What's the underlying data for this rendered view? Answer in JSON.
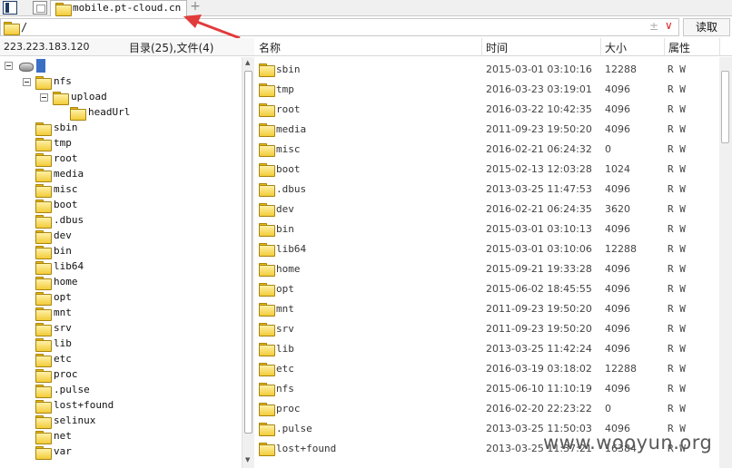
{
  "tabbar": {
    "tab_title": "mobile.pt-cloud.cn",
    "add_symbol": "+"
  },
  "address": {
    "path": "/",
    "plusminus": "±",
    "dropdown": "∨",
    "read_label": "读取"
  },
  "left_panel": {
    "ip": "223.223.183.120",
    "dir_count": "目录(25),文件(4)",
    "tree": [
      {
        "label": "nfs",
        "level": 1
      },
      {
        "label": "upload",
        "level": 2
      },
      {
        "label": "headUrl",
        "level": 3
      },
      {
        "label": "sbin",
        "level": 1
      },
      {
        "label": "tmp",
        "level": 1
      },
      {
        "label": "root",
        "level": 1
      },
      {
        "label": "media",
        "level": 1
      },
      {
        "label": "misc",
        "level": 1
      },
      {
        "label": "boot",
        "level": 1
      },
      {
        "label": ".dbus",
        "level": 1
      },
      {
        "label": "dev",
        "level": 1
      },
      {
        "label": "bin",
        "level": 1
      },
      {
        "label": "lib64",
        "level": 1
      },
      {
        "label": "home",
        "level": 1
      },
      {
        "label": "opt",
        "level": 1
      },
      {
        "label": "mnt",
        "level": 1
      },
      {
        "label": "srv",
        "level": 1
      },
      {
        "label": "lib",
        "level": 1
      },
      {
        "label": "etc",
        "level": 1
      },
      {
        "label": "proc",
        "level": 1
      },
      {
        "label": ".pulse",
        "level": 1
      },
      {
        "label": "lost+found",
        "level": 1
      },
      {
        "label": "selinux",
        "level": 1
      },
      {
        "label": "net",
        "level": 1
      },
      {
        "label": "var",
        "level": 1
      }
    ]
  },
  "file_list": {
    "columns": {
      "name": "名称",
      "time": "时间",
      "size": "大小",
      "attr": "属性"
    },
    "rows": [
      {
        "name": "sbin",
        "time": "2015-03-01 03:10:16",
        "size": "12288",
        "attr": "R W"
      },
      {
        "name": "tmp",
        "time": "2016-03-23 03:19:01",
        "size": "4096",
        "attr": "R W"
      },
      {
        "name": "root",
        "time": "2016-03-22 10:42:35",
        "size": "4096",
        "attr": "R W"
      },
      {
        "name": "media",
        "time": "2011-09-23 19:50:20",
        "size": "4096",
        "attr": "R W"
      },
      {
        "name": "misc",
        "time": "2016-02-21 06:24:32",
        "size": "0",
        "attr": "R W"
      },
      {
        "name": "boot",
        "time": "2015-02-13 12:03:28",
        "size": "1024",
        "attr": "R W"
      },
      {
        "name": ".dbus",
        "time": "2013-03-25 11:47:53",
        "size": "4096",
        "attr": "R W"
      },
      {
        "name": "dev",
        "time": "2016-02-21 06:24:35",
        "size": "3620",
        "attr": "R W"
      },
      {
        "name": "bin",
        "time": "2015-03-01 03:10:13",
        "size": "4096",
        "attr": "R W"
      },
      {
        "name": "lib64",
        "time": "2015-03-01 03:10:06",
        "size": "12288",
        "attr": "R W"
      },
      {
        "name": "home",
        "time": "2015-09-21 19:33:28",
        "size": "4096",
        "attr": "R W"
      },
      {
        "name": "opt",
        "time": "2015-06-02 18:45:55",
        "size": "4096",
        "attr": "R W"
      },
      {
        "name": "mnt",
        "time": "2011-09-23 19:50:20",
        "size": "4096",
        "attr": "R W"
      },
      {
        "name": "srv",
        "time": "2011-09-23 19:50:20",
        "size": "4096",
        "attr": "R W"
      },
      {
        "name": "lib",
        "time": "2013-03-25 11:42:24",
        "size": "4096",
        "attr": "R W"
      },
      {
        "name": "etc",
        "time": "2016-03-19 03:18:02",
        "size": "12288",
        "attr": "R W"
      },
      {
        "name": "nfs",
        "time": "2015-06-10 11:10:19",
        "size": "4096",
        "attr": "R W"
      },
      {
        "name": "proc",
        "time": "2016-02-20 22:23:22",
        "size": "0",
        "attr": "R W"
      },
      {
        "name": ".pulse",
        "time": "2013-03-25 11:50:03",
        "size": "4096",
        "attr": "R W"
      },
      {
        "name": "lost+found",
        "time": "2013-03-25 11:37:21",
        "size": "16384",
        "attr": "R W"
      }
    ]
  },
  "watermark": "www.wooyun.org",
  "colors": {
    "arrow": "#e23b3b",
    "folder": "#f2cc38",
    "selection": "#3b6fc4"
  }
}
